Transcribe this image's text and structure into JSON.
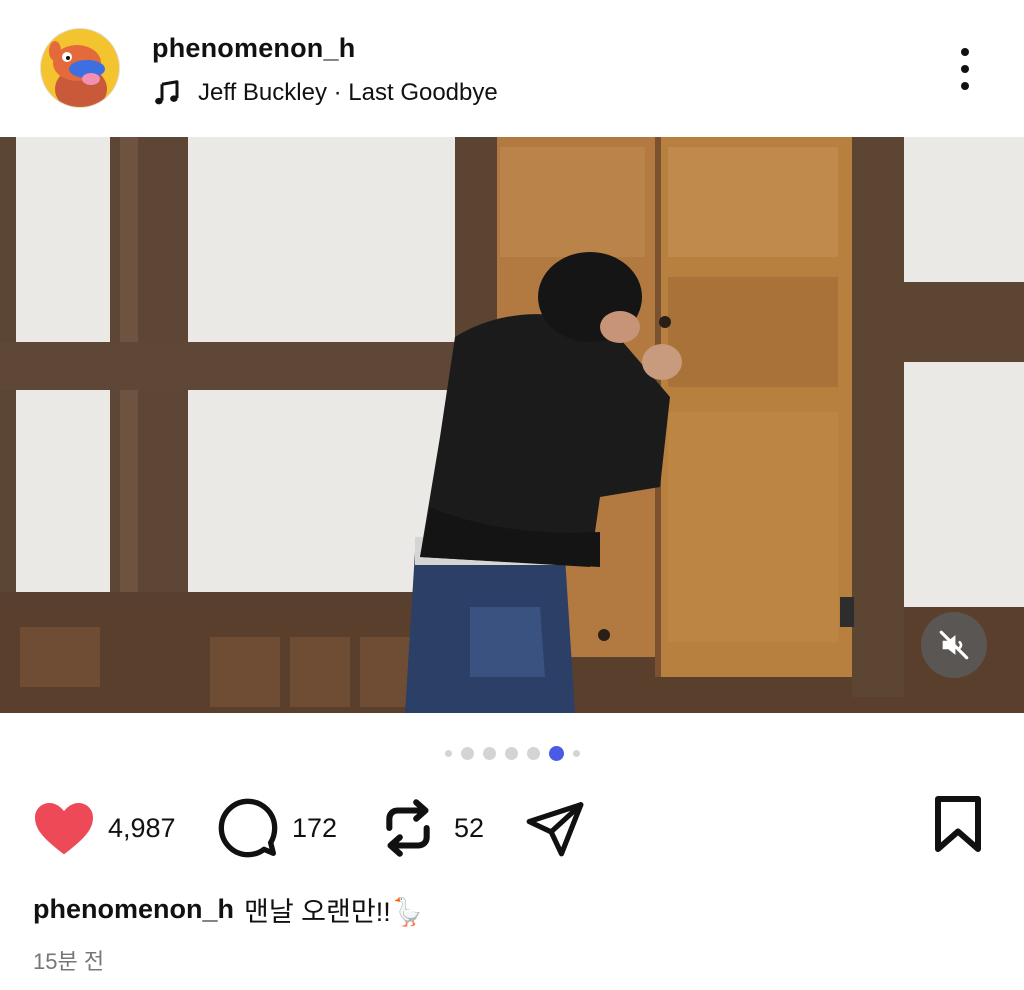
{
  "post": {
    "username": "phenomenon_h",
    "music": "Jeff Buckley · Last Goodbye",
    "icons": {
      "music": "music-note-icon",
      "more": "more-vertical-icon",
      "mute": "speaker-muted-icon"
    }
  },
  "carousel": {
    "total": 7,
    "active_index": 5
  },
  "actions": {
    "likes": "4,987",
    "comments": "172",
    "reposts": "52",
    "icons": {
      "like": "heart-filled-icon",
      "comment": "comment-bubble-icon",
      "repost": "repost-icon",
      "share": "send-icon",
      "save": "bookmark-icon"
    },
    "like_color": "#ed4956"
  },
  "caption": {
    "username": "phenomenon_h",
    "text": "맨날 오랜만!!🪿"
  },
  "timestamp": "15분 전",
  "colors": {
    "accent": "#4a5ce6",
    "text": "#111111",
    "muted": "#777777"
  }
}
